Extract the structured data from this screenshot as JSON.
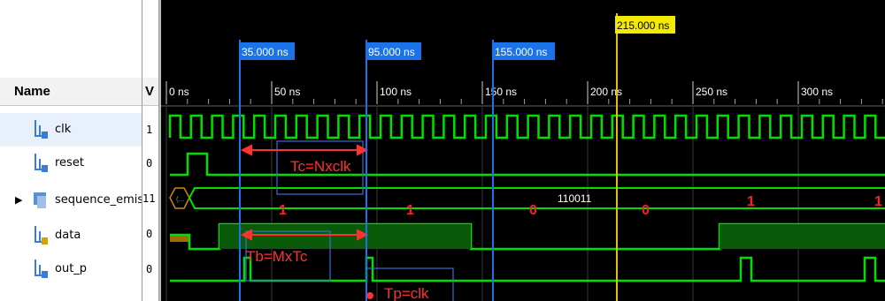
{
  "header": {
    "name_col": "Name",
    "value_col": "V"
  },
  "signals": [
    {
      "name": "clk",
      "value": "1"
    },
    {
      "name": "reset",
      "value": "0"
    },
    {
      "name": "sequence_emis",
      "value": "11"
    },
    {
      "name": "data",
      "value": "0"
    },
    {
      "name": "out_p",
      "value": "0"
    }
  ],
  "time_ticks": [
    "0 ns",
    "50 ns",
    "100 ns",
    "150 ns",
    "200 ns",
    "250 ns",
    "300 ns"
  ],
  "markers": [
    {
      "label": "35.000 ns",
      "color": "#1a73e8"
    },
    {
      "label": "95.000 ns",
      "color": "#1a73e8"
    },
    {
      "label": "155.000 ns",
      "color": "#1a73e8"
    },
    {
      "label": "215.000 ns",
      "color": "#e0c000"
    }
  ],
  "bus_values": {
    "collapsed": "(...",
    "digits": [
      "1",
      "1",
      "0",
      "0",
      "1",
      "1"
    ],
    "center": "110011"
  },
  "annotations": {
    "tc": "Tc=Nxclk",
    "tb": "Tb=MxTc",
    "tp": "Tp=clk"
  },
  "colors": {
    "wave": "#00e000",
    "bus_fill": "#0a5a0a",
    "annot": "#ff3030",
    "marker_blue": "#1a73e8",
    "cursor_yellow": "#e0c000",
    "bus_left": "#d08a00"
  }
}
